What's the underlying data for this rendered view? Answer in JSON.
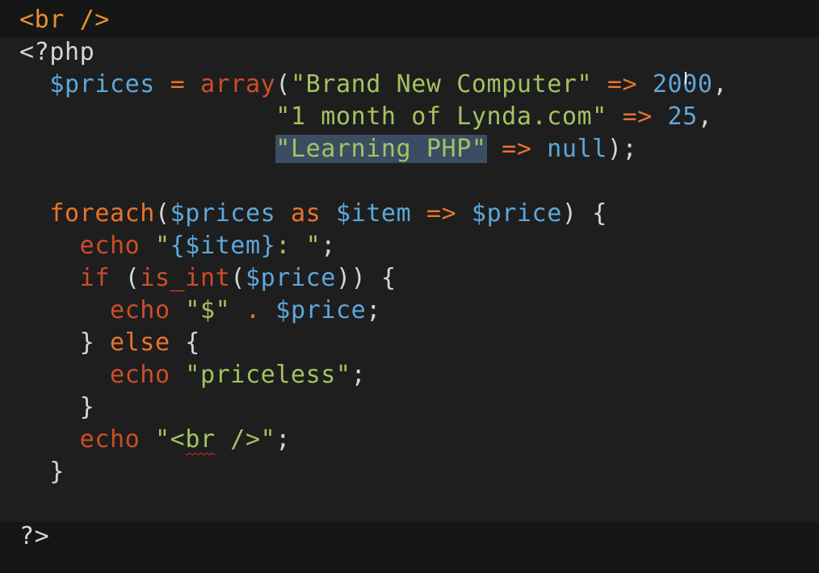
{
  "code_lines": [
    [
      {
        "t": "<br />",
        "c": "tag"
      }
    ],
    [
      {
        "t": "<?php",
        "c": "pun"
      }
    ],
    [
      {
        "t": "  ",
        "c": "pun"
      },
      {
        "t": "$prices",
        "c": "var"
      },
      {
        "t": " = ",
        "c": "op"
      },
      {
        "t": "array",
        "c": "kw"
      },
      {
        "t": "(",
        "c": "pun"
      },
      {
        "t": "\"Brand New Computer\"",
        "c": "str"
      },
      {
        "t": " => ",
        "c": "op"
      },
      {
        "t": "2000",
        "c": "num"
      },
      {
        "t": ",",
        "c": "pun"
      }
    ],
    [
      {
        "t": "                 ",
        "c": "pun"
      },
      {
        "t": "\"1 month of Lynda.com\"",
        "c": "str"
      },
      {
        "t": " => ",
        "c": "op"
      },
      {
        "t": "25",
        "c": "num"
      },
      {
        "t": ",",
        "c": "pun"
      }
    ],
    [
      {
        "t": "                 ",
        "c": "pun"
      },
      {
        "t": "\"Learning PHP\"",
        "c": "str sel"
      },
      {
        "t": " => ",
        "c": "op"
      },
      {
        "t": "null",
        "c": "nul"
      },
      {
        "t": ");",
        "c": "pun"
      }
    ],
    [],
    [
      {
        "t": "  ",
        "c": "pun"
      },
      {
        "t": "foreach",
        "c": "op"
      },
      {
        "t": "(",
        "c": "pun"
      },
      {
        "t": "$prices",
        "c": "var"
      },
      {
        "t": " as ",
        "c": "op"
      },
      {
        "t": "$item",
        "c": "var"
      },
      {
        "t": " => ",
        "c": "op"
      },
      {
        "t": "$price",
        "c": "var"
      },
      {
        "t": ") {",
        "c": "pun"
      }
    ],
    [
      {
        "t": "    ",
        "c": "pun"
      },
      {
        "t": "echo",
        "c": "kw"
      },
      {
        "t": " \"",
        "c": "str"
      },
      {
        "t": "{$item}",
        "c": "var"
      },
      {
        "t": ": \"",
        "c": "str"
      },
      {
        "t": ";",
        "c": "pun"
      }
    ],
    [
      {
        "t": "    ",
        "c": "pun"
      },
      {
        "t": "if",
        "c": "kw"
      },
      {
        "t": " (",
        "c": "pun"
      },
      {
        "t": "is_int",
        "c": "kw"
      },
      {
        "t": "(",
        "c": "pun"
      },
      {
        "t": "$price",
        "c": "var"
      },
      {
        "t": ")) {",
        "c": "pun"
      }
    ],
    [
      {
        "t": "      ",
        "c": "pun"
      },
      {
        "t": "echo",
        "c": "kw"
      },
      {
        "t": " \"$\"",
        "c": "str"
      },
      {
        "t": " . ",
        "c": "op"
      },
      {
        "t": "$price",
        "c": "var"
      },
      {
        "t": ";",
        "c": "pun"
      }
    ],
    [
      {
        "t": "    } ",
        "c": "pun"
      },
      {
        "t": "else",
        "c": "op"
      },
      {
        "t": " {",
        "c": "pun"
      }
    ],
    [
      {
        "t": "      ",
        "c": "pun"
      },
      {
        "t": "echo",
        "c": "kw"
      },
      {
        "t": " \"priceless\"",
        "c": "str"
      },
      {
        "t": ";",
        "c": "pun"
      }
    ],
    [
      {
        "t": "    }",
        "c": "pun"
      }
    ],
    [
      {
        "t": "    ",
        "c": "pun"
      },
      {
        "t": "echo",
        "c": "kw"
      },
      {
        "t": " \"<",
        "c": "str"
      },
      {
        "t": "br",
        "c": "str squig"
      },
      {
        "t": " />\"",
        "c": "str"
      },
      {
        "t": ";",
        "c": "pun"
      }
    ],
    [
      {
        "t": "  }",
        "c": "pun"
      }
    ],
    [],
    [
      {
        "t": "?>",
        "c": "pun"
      }
    ]
  ],
  "colors": {
    "background": "#1e1e1e",
    "html_region": "#161616",
    "keyword": "#cc4d2b",
    "operator": "#e9742c",
    "variable": "#5ca8dc",
    "string": "#a5c261",
    "number": "#5ea6d8",
    "selection": "#3a4d63",
    "text": "#d6d6d6"
  },
  "cursor_icon": "i-beam-cursor"
}
